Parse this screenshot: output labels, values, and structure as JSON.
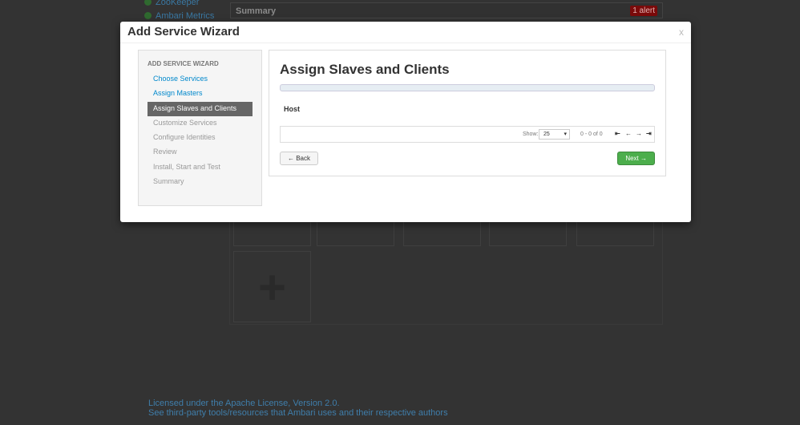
{
  "background": {
    "services": [
      "ZooKeeper",
      "Ambari Metrics"
    ],
    "summary": "Summary",
    "alert": "1 alert",
    "footer": [
      "Licensed under the Apache License, Version 2.0.",
      "See third-party tools/resources that Ambari uses and their respective authors"
    ]
  },
  "modal": {
    "title": "Add Service Wizard",
    "close": "x",
    "sidebar": {
      "heading": "ADD SERVICE WIZARD",
      "steps": [
        "Choose Services",
        "Assign Masters",
        "Assign Slaves and Clients",
        "Customize Services",
        "Configure Identities",
        "Review",
        "Install, Start and Test",
        "Summary"
      ]
    },
    "main": {
      "title": "Assign Slaves and Clients",
      "column": "Host",
      "show_label": "Show:",
      "page_size": "25",
      "range": "0 - 0 of 0",
      "back": "← Back",
      "next": "Next →"
    }
  }
}
